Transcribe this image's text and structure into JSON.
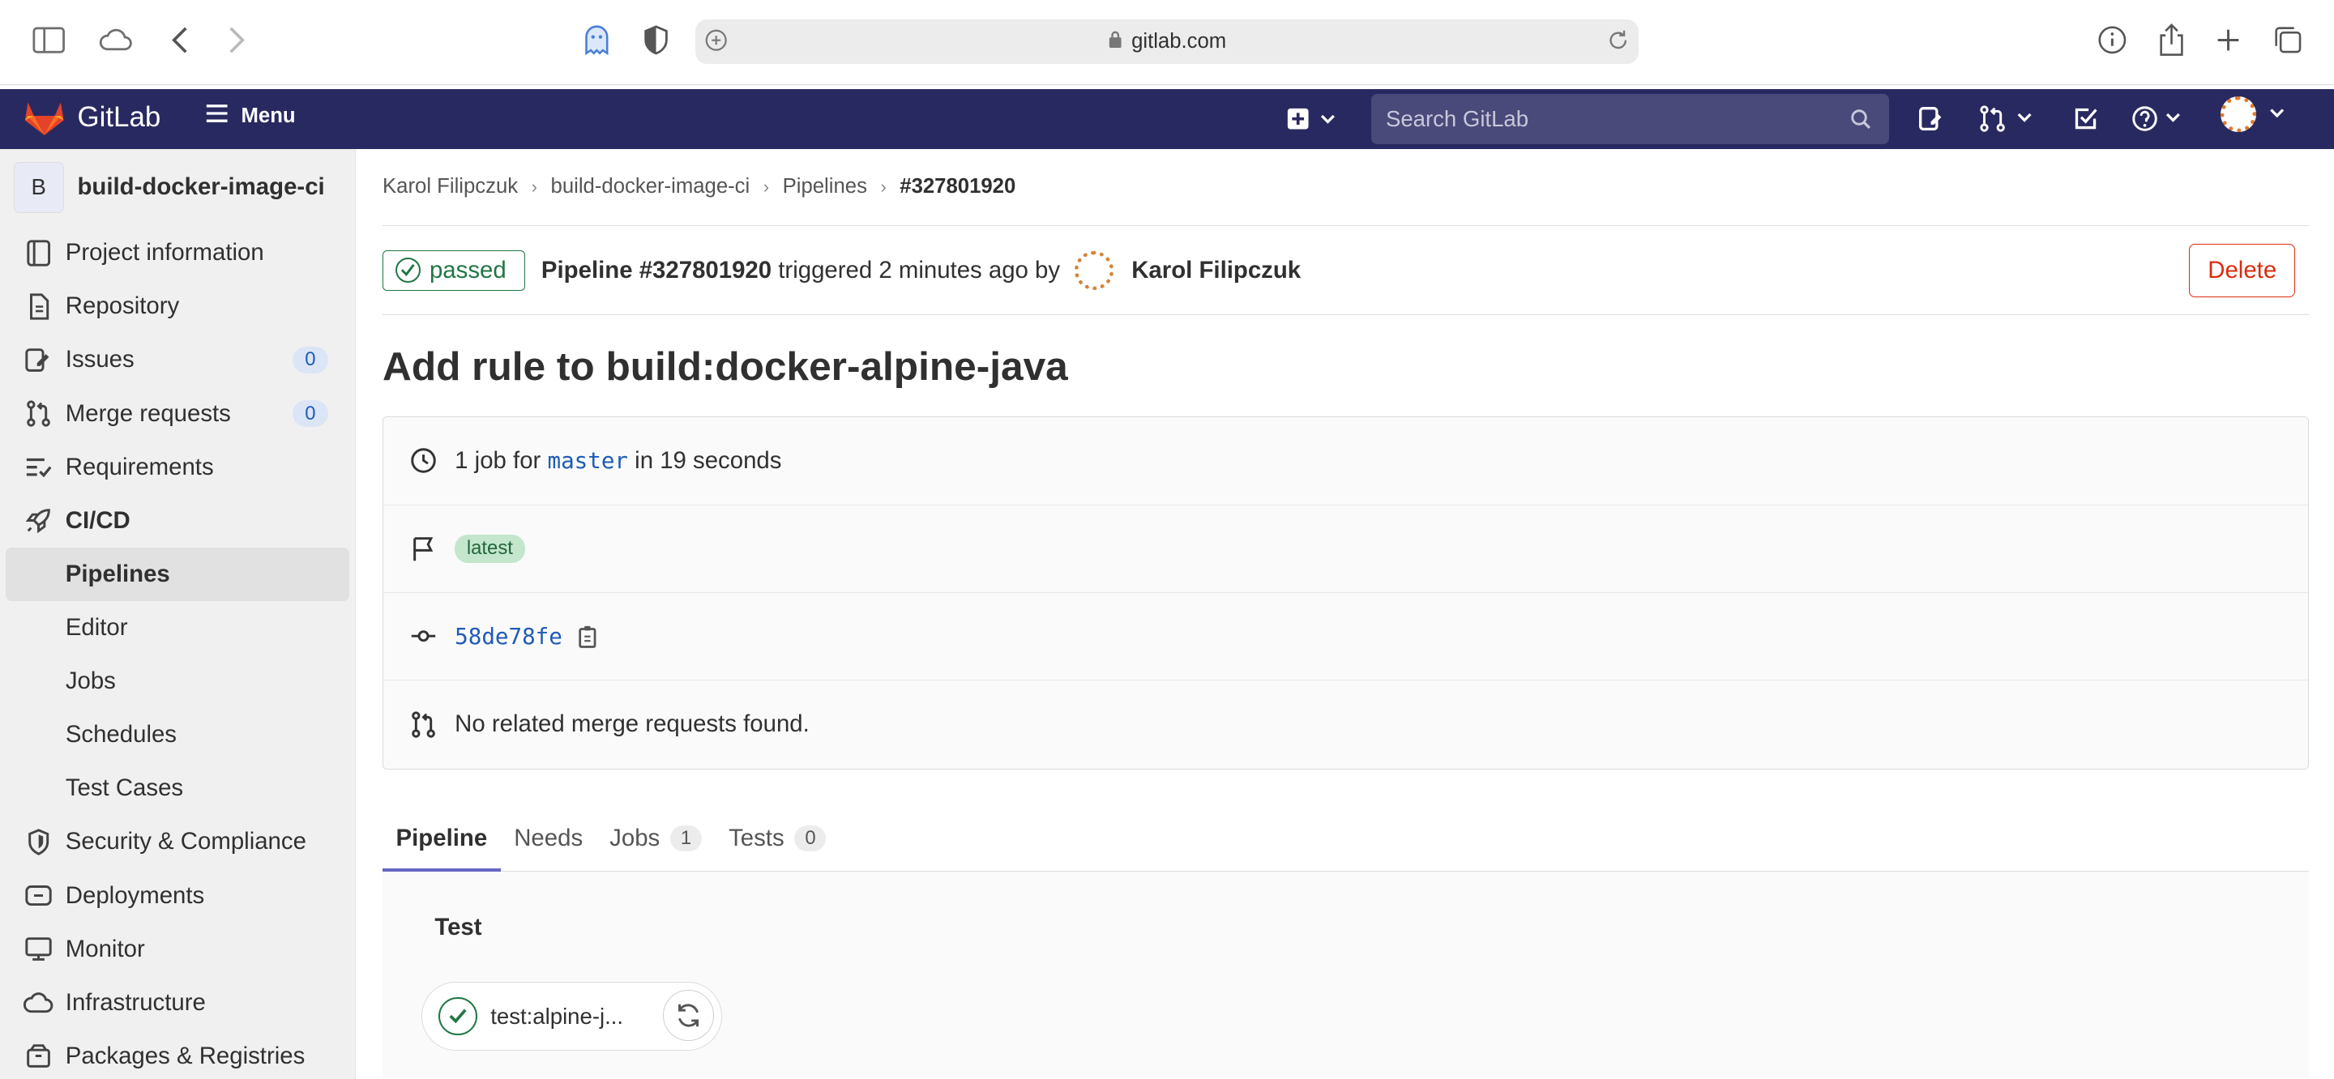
{
  "browser": {
    "url": "gitlab.com"
  },
  "gitlab_nav": {
    "brand": "GitLab",
    "menu_label": "Menu",
    "search_placeholder": "Search GitLab"
  },
  "sidebar": {
    "project_initial": "B",
    "project_name": "build-docker-image-ci",
    "items": [
      {
        "label": "Project information",
        "icon": "project-info-icon"
      },
      {
        "label": "Repository",
        "icon": "repository-icon"
      },
      {
        "label": "Issues",
        "icon": "issues-icon",
        "count": "0"
      },
      {
        "label": "Merge requests",
        "icon": "merge-request-icon",
        "count": "0"
      },
      {
        "label": "Requirements",
        "icon": "requirements-icon"
      },
      {
        "label": "CI/CD",
        "icon": "rocket-icon"
      }
    ],
    "cicd_subitems": [
      "Pipelines",
      "Editor",
      "Jobs",
      "Schedules",
      "Test Cases"
    ],
    "bottom_items": [
      {
        "label": "Security & Compliance",
        "icon": "shield-icon"
      },
      {
        "label": "Deployments",
        "icon": "deployments-icon"
      },
      {
        "label": "Monitor",
        "icon": "monitor-icon"
      },
      {
        "label": "Infrastructure",
        "icon": "cloud-icon"
      },
      {
        "label": "Packages & Registries",
        "icon": "package-icon"
      }
    ]
  },
  "breadcrumb": [
    "Karol Filipczuk",
    "build-docker-image-ci",
    "Pipelines",
    "#327801920"
  ],
  "pipeline": {
    "status": "passed",
    "title": "Pipeline #327801920",
    "triggered": "triggered 2 minutes ago by",
    "user": "Karol Filipczuk",
    "delete_label": "Delete",
    "commit_title": "Add rule to build:docker-alpine-java",
    "jobs_prefix": "1 job for",
    "branch": "master",
    "duration": "in 19 seconds",
    "badge": "latest",
    "sha": "58de78fe",
    "mr_text": "No related merge requests found."
  },
  "tabs": [
    {
      "label": "Pipeline"
    },
    {
      "label": "Needs"
    },
    {
      "label": "Jobs",
      "count": "1"
    },
    {
      "label": "Tests",
      "count": "0"
    }
  ],
  "graph": {
    "stage": "Test",
    "job_name": "test:alpine-j..."
  },
  "colors": {
    "nav_bg": "#292961",
    "success": "#217645",
    "danger": "#dd2b0e",
    "link": "#1f5bb5"
  }
}
